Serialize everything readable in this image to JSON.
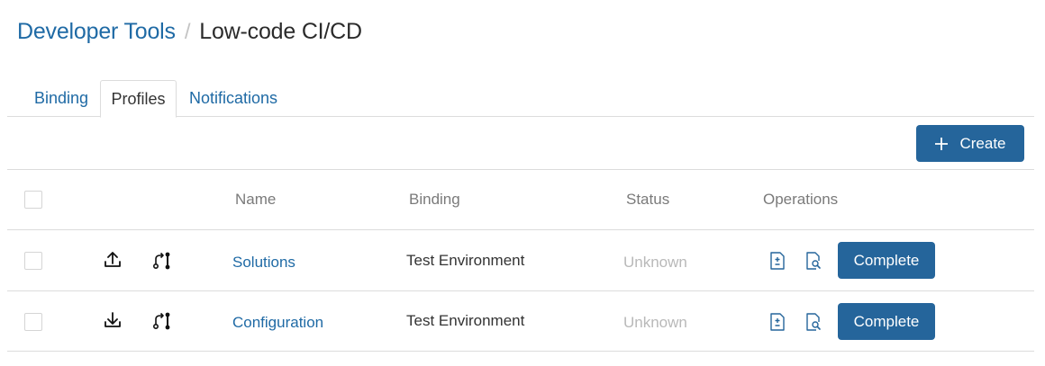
{
  "breadcrumb": {
    "parent": "Developer Tools",
    "separator": "/",
    "current": "Low-code CI/CD"
  },
  "tabs": [
    {
      "label": "Binding",
      "active": false
    },
    {
      "label": "Profiles",
      "active": true
    },
    {
      "label": "Notifications",
      "active": false
    }
  ],
  "toolbar": {
    "create_label": "Create",
    "create_icon": "plus-icon"
  },
  "table": {
    "columns": [
      "Name",
      "Binding",
      "Status",
      "Operations"
    ],
    "rows": [
      {
        "direction_icon": "upload-icon",
        "branch_icon": "pull-request-icon",
        "name": "Solutions",
        "binding": "Test Environment",
        "status": "Unknown",
        "operation_icons": [
          "file-diff-icon",
          "file-search-icon"
        ],
        "action_label": "Complete"
      },
      {
        "direction_icon": "download-icon",
        "branch_icon": "pull-request-icon",
        "name": "Configuration",
        "binding": "Test Environment",
        "status": "Unknown",
        "operation_icons": [
          "file-diff-icon",
          "file-search-icon"
        ],
        "action_label": "Complete"
      }
    ]
  },
  "colors": {
    "accent": "#1f6aa5",
    "button": "#25659b",
    "status_unknown": "#b9b9b9",
    "border": "#dcdcdc"
  }
}
